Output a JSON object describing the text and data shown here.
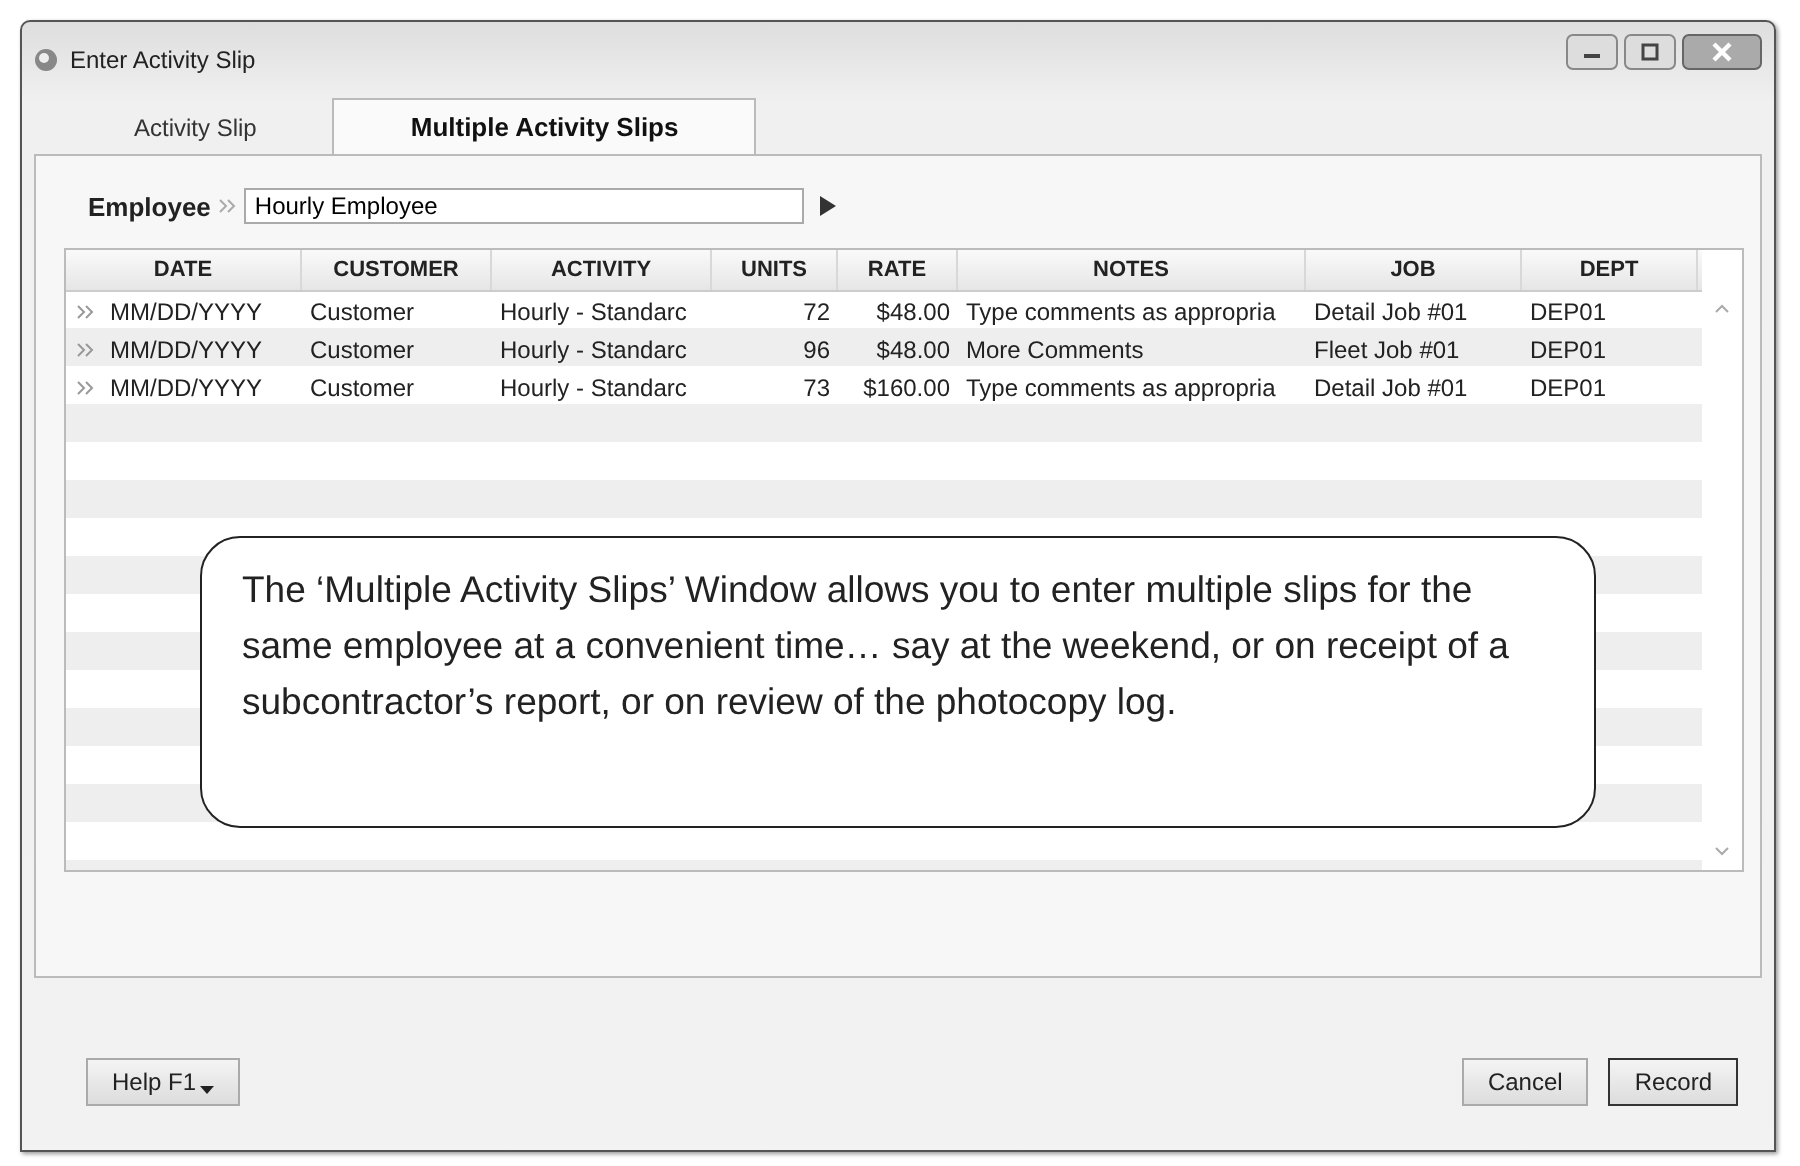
{
  "window": {
    "title": "Enter Activity Slip"
  },
  "tabs": [
    {
      "label": "Activity Slip",
      "selected": false
    },
    {
      "label": "Multiple Activity Slips",
      "selected": true
    }
  ],
  "employee": {
    "label": "Employee",
    "value": "Hourly Employee"
  },
  "table": {
    "columns": [
      "DATE",
      "CUSTOMER",
      "ACTIVITY",
      "UNITS",
      "RATE",
      "NOTES",
      "JOB",
      "DEPT"
    ],
    "rows": [
      [
        "MM/DD/YYYY",
        "Customer",
        "Hourly - Standarc",
        "72",
        "$48.00",
        "Type comments as appropria",
        "Detail Job #01",
        "DEP01"
      ],
      [
        "MM/DD/YYYY",
        "Customer",
        "Hourly - Standarc",
        "96",
        "$48.00",
        "More Comments",
        "Fleet Job #01",
        "DEP01"
      ],
      [
        "MM/DD/YYYY",
        "Customer",
        "Hourly - Standarc",
        "73",
        "$160.00",
        "Type comments as appropria",
        "Detail Job #01",
        "DEP01"
      ]
    ]
  },
  "callout": "The ‘Multiple Activity Slips’ Window allows you to enter multiple slips for the same employee at a convenient time… say at the weekend, or on receipt of a subcontractor’s report, or on review of the photocopy log.",
  "buttons": {
    "help": "Help F1",
    "cancel": "Cancel",
    "record": "Record"
  }
}
